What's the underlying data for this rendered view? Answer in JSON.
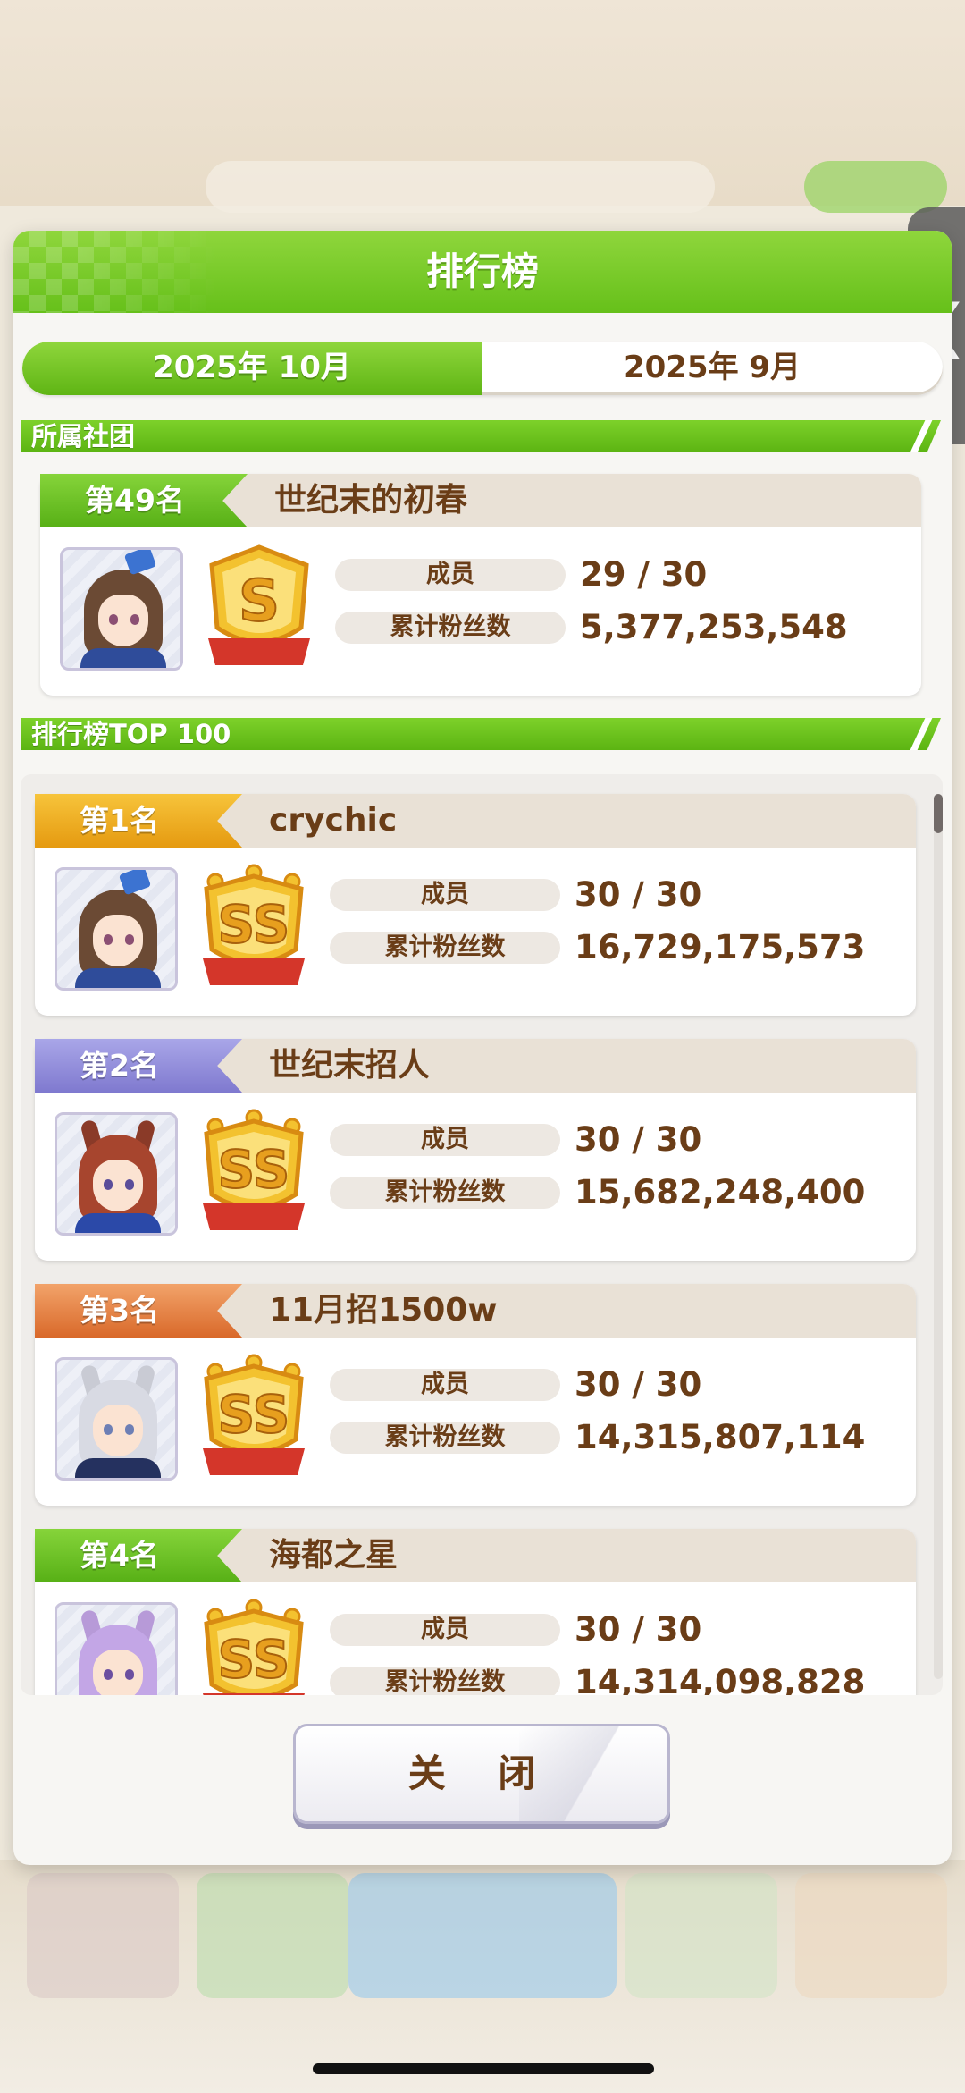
{
  "modal": {
    "title": "排行榜",
    "close_label": "关 闭"
  },
  "month_tabs": [
    {
      "label": "2025年 10月",
      "active": true
    },
    {
      "label": "2025年 9月",
      "active": false
    }
  ],
  "sections": {
    "my_club": "所属社团",
    "top100": "排行榜TOP 100"
  },
  "stat_labels": {
    "members": "成员",
    "fans": "累计粉丝数"
  },
  "my_club": {
    "rank": "第49名",
    "name": "世纪末的初春",
    "grade": "S",
    "members": "29 / 30",
    "fans": "5,377,253,548",
    "avatar": "brown-hair-character"
  },
  "ranking": [
    {
      "rank": "第1名",
      "tag": "gold",
      "name": "crychic",
      "grade": "SS",
      "members": "30 / 30",
      "fans": "16,729,175,573",
      "avatar": "brown-hair-character"
    },
    {
      "rank": "第2名",
      "tag": "silver",
      "name": "世纪末招人",
      "grade": "SS",
      "members": "30 / 30",
      "fans": "15,682,248,400",
      "avatar": "red-hair-character"
    },
    {
      "rank": "第3名",
      "tag": "bronze",
      "name": "11月招1500w",
      "grade": "SS",
      "members": "30 / 30",
      "fans": "14,315,807,114",
      "avatar": "silver-hair-character"
    },
    {
      "rank": "第4名",
      "tag": "green",
      "name": "海都之星",
      "grade": "SS",
      "members": "30 / 30",
      "fans": "14,314,098,828",
      "avatar": "purple-hair-character"
    }
  ],
  "colors": {
    "accent_green": "#6cc41f",
    "text_brown": "#6a3d17",
    "gold": "#f0b02a",
    "silver": "#8f89d9",
    "bronze": "#e47a35"
  }
}
